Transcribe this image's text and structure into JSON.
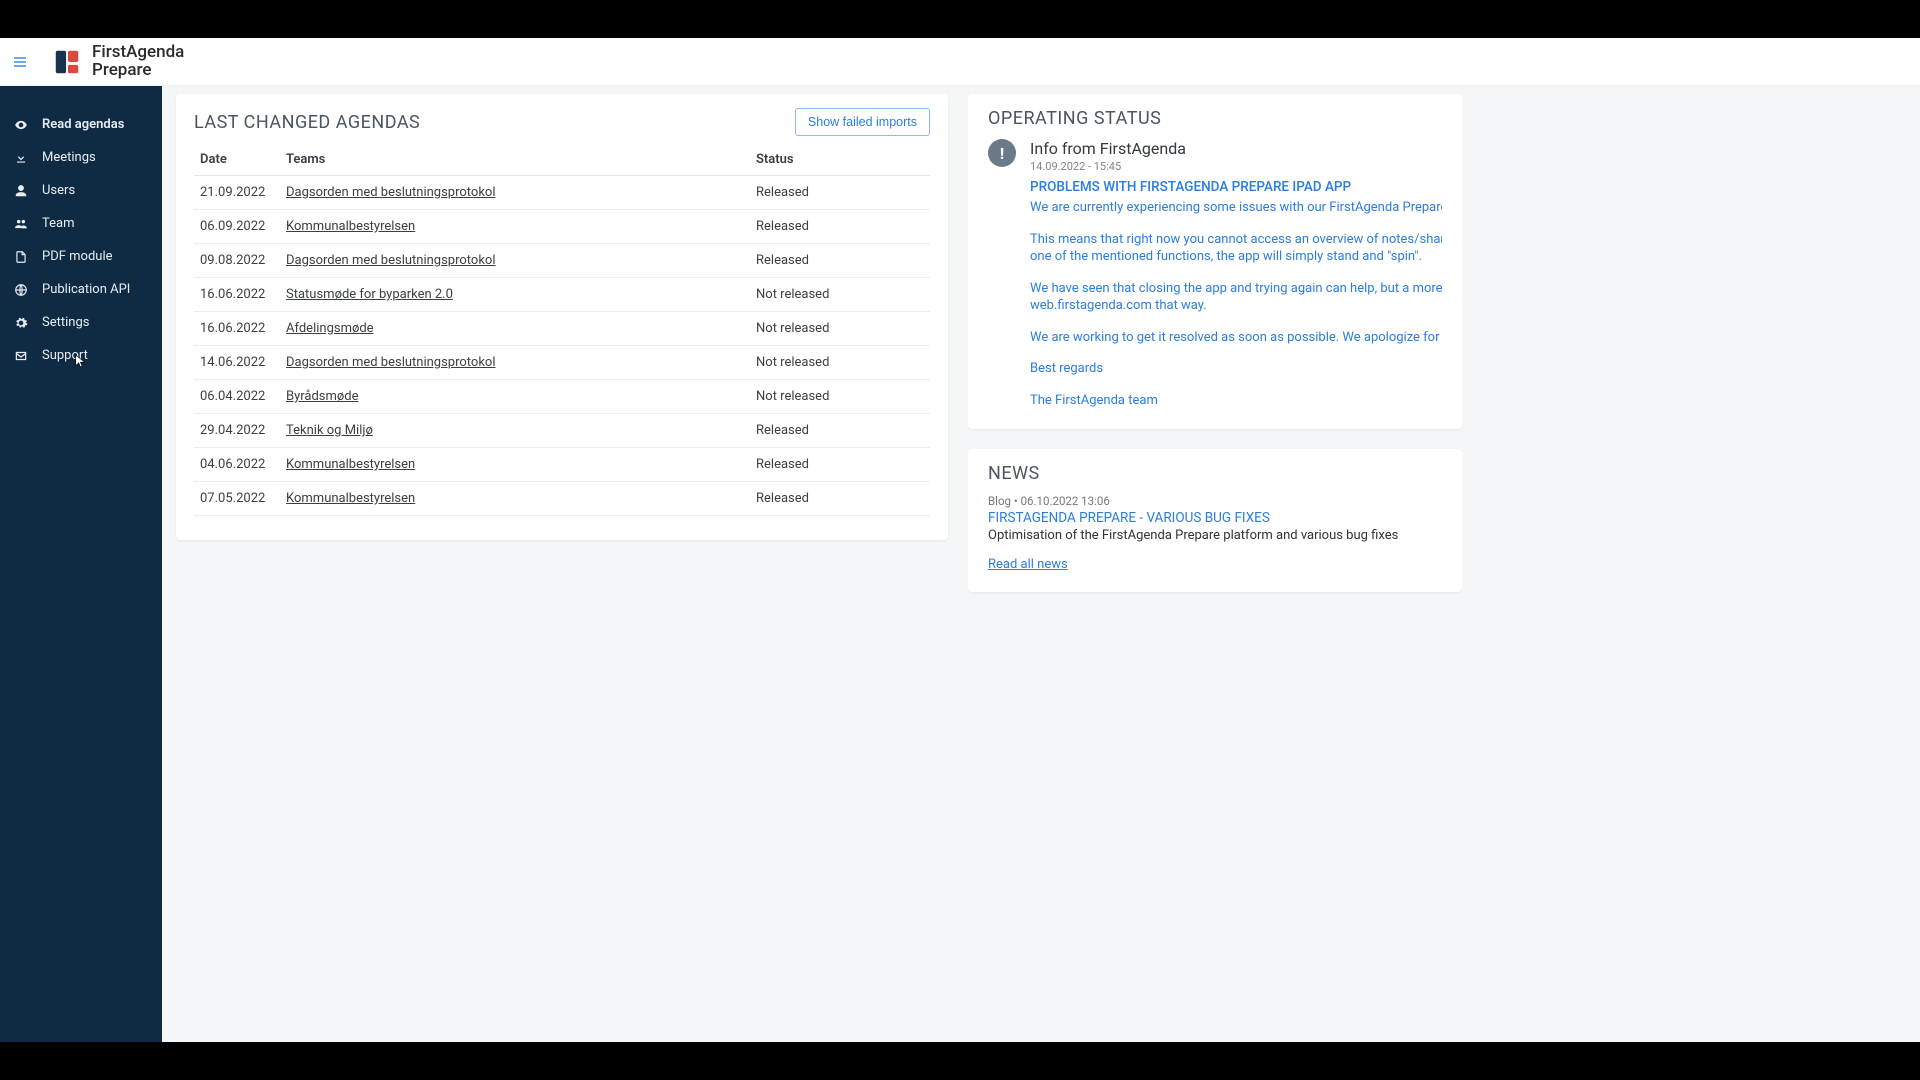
{
  "logo": {
    "line1": "FirstAgenda",
    "line2": "Prepare"
  },
  "sidebar": {
    "items": [
      {
        "label": "Read agendas"
      },
      {
        "label": "Meetings"
      },
      {
        "label": "Users"
      },
      {
        "label": "Team"
      },
      {
        "label": "PDF module"
      },
      {
        "label": "Publication API"
      },
      {
        "label": "Settings"
      },
      {
        "label": "Support"
      }
    ]
  },
  "agendas": {
    "title": "LAST CHANGED AGENDAS",
    "show_failed": "Show failed imports",
    "headers": {
      "date": "Date",
      "teams": "Teams",
      "status": "Status"
    },
    "rows": [
      {
        "date": "21.09.2022",
        "team": "Dagsorden med beslutningsprotokol",
        "status": "Released"
      },
      {
        "date": "06.09.2022",
        "team": "Kommunalbestyrelsen",
        "status": "Released"
      },
      {
        "date": "09.08.2022",
        "team": "Dagsorden med beslutningsprotokol",
        "status": "Released"
      },
      {
        "date": "16.06.2022",
        "team": "Statusmøde for byparken 2.0",
        "status": "Not released"
      },
      {
        "date": "16.06.2022",
        "team": "Afdelingsmøde",
        "status": "Not released"
      },
      {
        "date": "14.06.2022",
        "team": "Dagsorden med beslutningsprotokol",
        "status": "Not released"
      },
      {
        "date": "06.04.2022",
        "team": "Byrådsmøde",
        "status": "Not released"
      },
      {
        "date": "29.04.2022",
        "team": "Teknik og Miljø",
        "status": "Released"
      },
      {
        "date": "04.06.2022",
        "team": "Kommunalbestyrelsen",
        "status": "Released"
      },
      {
        "date": "07.05.2022",
        "team": "Kommunalbestyrelsen",
        "status": "Released"
      }
    ]
  },
  "operating_status": {
    "title": "OPERATING STATUS",
    "info_title": "Info from FirstAgenda",
    "info_date": "14.09.2022 - 15:45",
    "headline": "PROBLEMS WITH FIRSTAGENDA PREPARE IPAD APP",
    "p1": "We are currently experiencing some issues with our FirstAgenda Prepare app for ipad.",
    "p2a": "This means that right now you cannot access an overview of notes/shared comments, notifications,",
    "p2b": "one of the mentioned functions, the app will simply stand and \"spin\".",
    "p3a": "We have seen that closing the app and trying again can help, but a more durable workaround would b",
    "p3b": "web.firstagenda.com that way.",
    "p4": "We are working to get it resolved as soon as possible. We apologize for the inconvenience.",
    "p5": "Best regards",
    "p6": "The FirstAgenda team"
  },
  "news": {
    "title": "NEWS",
    "meta": "Blog • 06.10.2022 13:06",
    "headline": "FIRSTAGENDA PREPARE - VARIOUS BUG FIXES",
    "desc": "Optimisation of the FirstAgenda Prepare platform and various bug fixes",
    "read_all": "Read all news"
  }
}
